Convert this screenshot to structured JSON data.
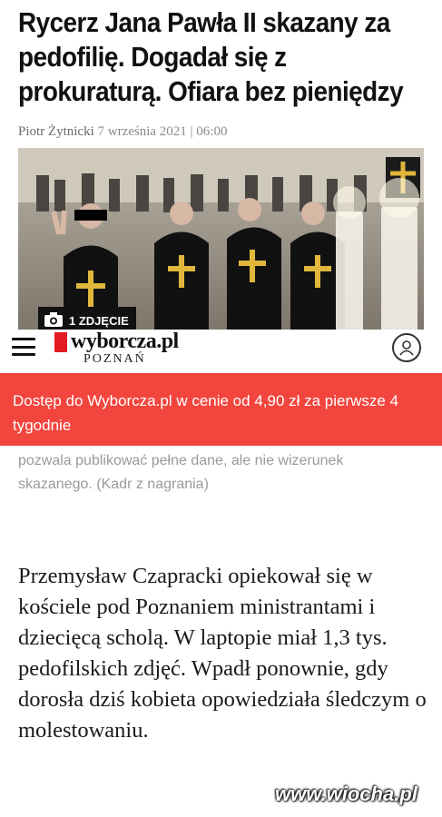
{
  "article": {
    "headline": "Rycerz Jana Pawła II skazany za pedofilię. Dogadał się z prokuraturą. Ofiara bez pieniędzy",
    "author": "Piotr Żytnicki",
    "date": "7 września 2021 | 06:00",
    "photo_badge": "1 ZDJĘCIE",
    "caption": "pozwala publikować pełne dane, ale nie wizerunek skazanego. (Kadr z nagrania)",
    "body": "Przemysław Czapracki opiekował się w kościele pod Poznaniem ministrantami i dziecięcą scholą. W laptopie miał 1,3 tys. pedofilskich zdjęć. Wpadł ponownie, gdy dorosła dziś kobieta opowiedziała śledczym o molestowaniu."
  },
  "header": {
    "logo": "wyborcza.pl",
    "city": "POZNAŃ"
  },
  "banner": {
    "text": "Dostęp do Wyborcza.pl w cenie od 4,90 zł za pierwsze 4 tygodnie"
  },
  "watermark": "www.wiocha.pl",
  "colors": {
    "banner_bg": "#f2453d",
    "logo_red": "#e21b23"
  },
  "icons": {
    "menu": "hamburger-menu-icon",
    "account": "user-account-icon",
    "camera": "camera-icon"
  }
}
